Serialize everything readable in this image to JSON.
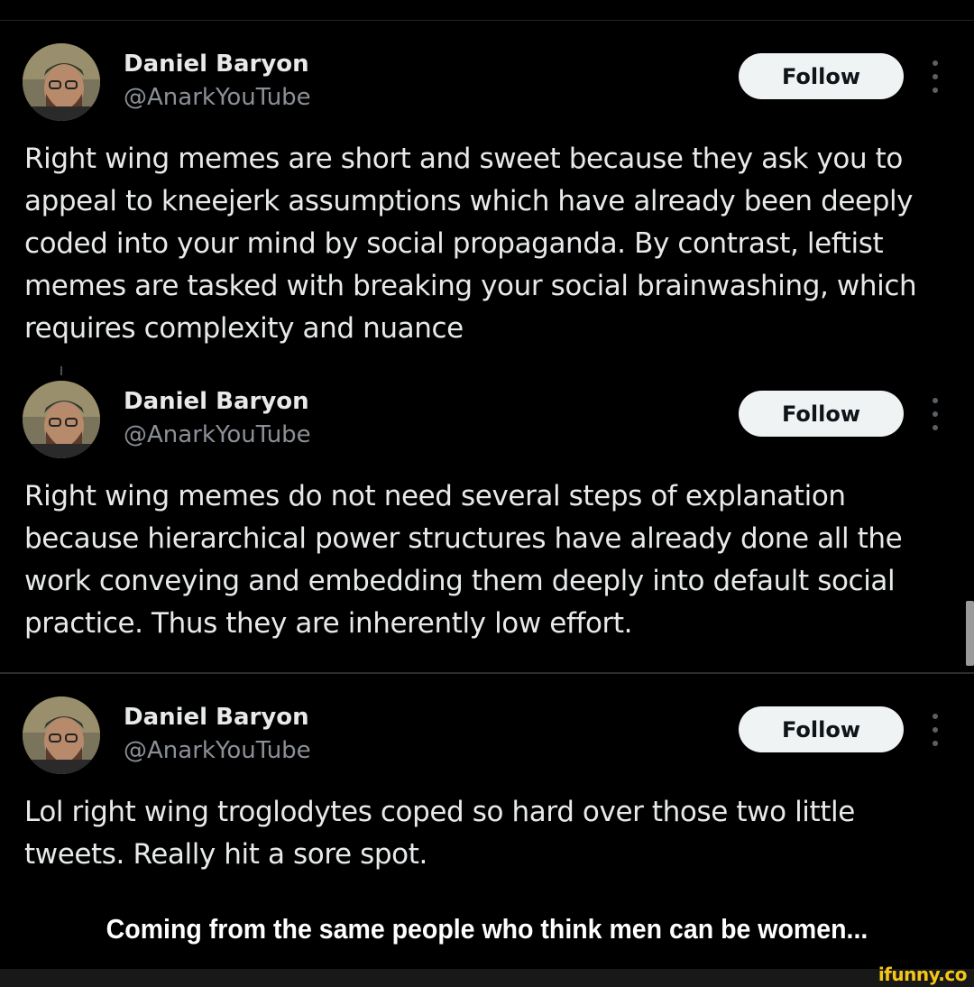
{
  "posts": [
    {
      "author_name": "Daniel Baryon",
      "author_handle": "@AnarkYouTube",
      "follow_label": "Follow",
      "text": "Right wing memes are short and sweet because they ask you to appeal to kneejerk assumptions which have already been deeply coded into your mind by social propaganda. By contrast, leftist memes are tasked with breaking your social brainwashing, which requires complexity and nuance"
    },
    {
      "author_name": "Daniel Baryon",
      "author_handle": "@AnarkYouTube",
      "follow_label": "Follow",
      "text": "Right wing memes do not need several steps of explanation because hierarchical power structures have already done all the work conveying and embedding them deeply into default social practice. Thus they are inherently low effort."
    },
    {
      "author_name": "Daniel Baryon",
      "author_handle": "@AnarkYouTube",
      "follow_label": "Follow",
      "text": "Lol right wing troglodytes coped so hard over those two little tweets. Really hit a sore spot."
    }
  ],
  "caption": "Coming from the same people who think men can be women...",
  "watermark": "ifunny.co",
  "icons": {
    "more": "more-vertical-icon",
    "avatar": "profile-avatar"
  },
  "colors": {
    "background": "#000000",
    "text_primary": "#e7e9ea",
    "text_secondary": "#8b9096",
    "button_bg": "#eff3f4",
    "watermark": "#f5c518"
  }
}
